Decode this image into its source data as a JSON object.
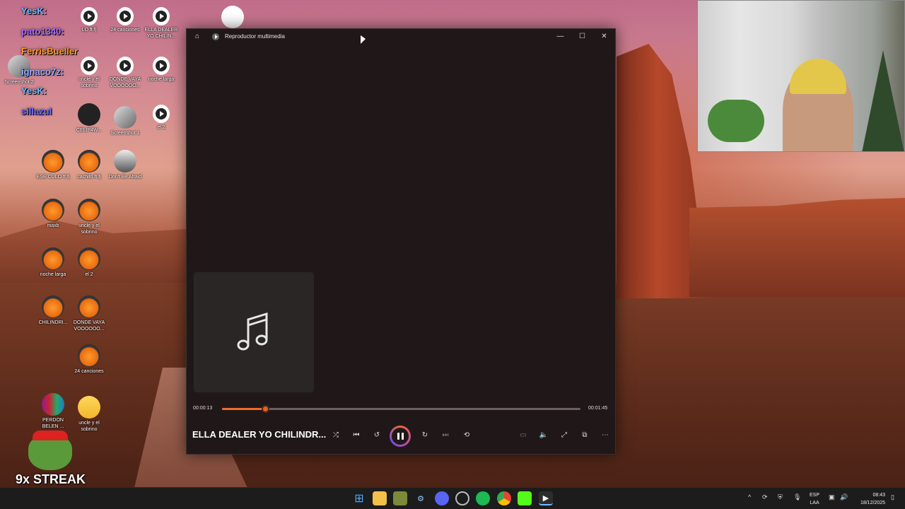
{
  "chat": [
    {
      "user": "YesK:",
      "color": "#6fb6ff"
    },
    {
      "user": "pato1340:",
      "color": "#a66bff"
    },
    {
      "user": "FerrisBueller",
      "color": "#ff9a2b"
    },
    {
      "user": "ignaco7z:",
      "color": "#9ab0ff"
    },
    {
      "user": "YesK:",
      "color": "#6fb6ff"
    },
    {
      "user": "sillazul",
      "color": "#6b6bff"
    }
  ],
  "desktop": {
    "videos": [
      {
        "label": "LO ft fj"
      },
      {
        "label": "24 canciones"
      },
      {
        "label": "ELLA DEALER YO CHILIN..."
      },
      {
        "label": "uncle y el sobrino"
      },
      {
        "label": "DONDE VAYA VOOOOOO..."
      },
      {
        "label": "noche larga"
      },
      {
        "label": "el 2"
      }
    ],
    "other": [
      {
        "label": "Screenshot 2"
      },
      {
        "label": "Screenshot 1"
      },
      {
        "label": "Don't Be Afraid"
      },
      {
        "label": "CELIP4W..."
      }
    ],
    "fl_projects": [
      {
        "label": "ESE CULO ft fj"
      },
      {
        "label": "cachito ft fj"
      },
      {
        "label": "maxb"
      },
      {
        "label": "uncle y el sobrino"
      },
      {
        "label": "noche larga"
      },
      {
        "label": "el 2"
      },
      {
        "label": "CHILINDRI..."
      },
      {
        "label": "DONDE VAYA VOOOOOO..."
      },
      {
        "label": "24 canciones"
      }
    ],
    "rar": {
      "label": "PERDON BELEN ..."
    },
    "folder": {
      "label": "uncle y el sobrino"
    }
  },
  "player": {
    "title": "Reproductor multimedia",
    "elapsed": "00:00:13",
    "duration": "00:01:45",
    "progress_fraction": 0.12,
    "song": "ELLA DEALER YO CHILINDR...",
    "accent": "#f06a2a"
  },
  "streak": "9x STREAK",
  "taskbar": {
    "lang_top": "ESP",
    "lang_bottom": "LAA",
    "time": "08:43",
    "date": "18/12/2025"
  }
}
